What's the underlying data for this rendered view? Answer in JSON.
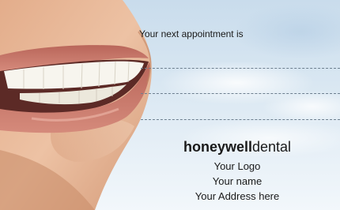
{
  "appointment": {
    "label": "Your next appointment is"
  },
  "brand": {
    "bold": "honeywell",
    "regular": "dental"
  },
  "details": {
    "logo": "Your Logo",
    "name": "Your name",
    "address": "Your Address here"
  },
  "colors": {
    "sky": "#d9e7f2",
    "skin": "#e7b695",
    "lips": "#c77668",
    "teeth": "#f7f5ee",
    "text": "#1a1a1a",
    "dash": "#6d7f8f"
  }
}
